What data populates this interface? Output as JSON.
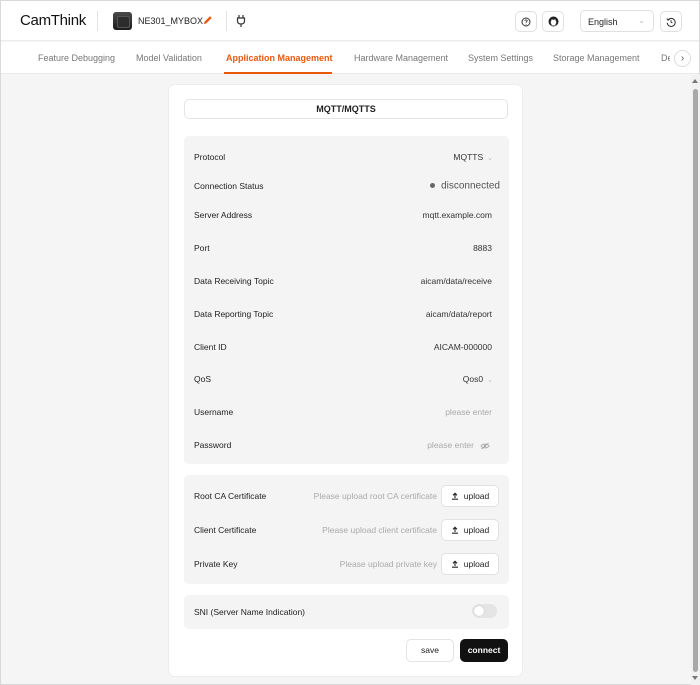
{
  "header": {
    "logo": "CamThink",
    "device_name": "NE301_MYBOX",
    "language": "English"
  },
  "tabs": [
    {
      "label": "Feature Debugging"
    },
    {
      "label": "Model Validation"
    },
    {
      "label": "Application Management",
      "active": true
    },
    {
      "label": "Hardware Management"
    },
    {
      "label": "System Settings"
    },
    {
      "label": "Storage Management"
    },
    {
      "label": "De"
    }
  ],
  "protocol_tab": "MQTT/MQTTS",
  "settings": {
    "protocol": {
      "label": "Protocol",
      "value": "MQTTS"
    },
    "connection_status": {
      "label": "Connection Status",
      "value": "disconnected"
    },
    "server_address": {
      "label": "Server Address",
      "value": "mqtt.example.com"
    },
    "port": {
      "label": "Port",
      "value": "8883"
    },
    "receiving_topic": {
      "label": "Data Receiving Topic",
      "value": "aicam/data/receive"
    },
    "reporting_topic": {
      "label": "Data Reporting Topic",
      "value": "aicam/data/report"
    },
    "client_id": {
      "label": "Client ID",
      "value": "AICAM-000000"
    },
    "qos": {
      "label": "QoS",
      "value": "Qos0"
    },
    "username": {
      "label": "Username",
      "placeholder": "please enter"
    },
    "password": {
      "label": "Password",
      "placeholder": "please enter"
    }
  },
  "certificates": {
    "root_ca": {
      "label": "Root CA Certificate",
      "hint": "Please upload root CA certificate",
      "button": "upload"
    },
    "client_cert": {
      "label": "Client Certificate",
      "hint": "Please upload client certificate",
      "button": "upload"
    },
    "private_key": {
      "label": "Private Key",
      "hint": "Please upload private key",
      "button": "upload"
    }
  },
  "sni": {
    "label": "SNI (Server Name Indication)",
    "enabled": false
  },
  "actions": {
    "save": "save",
    "connect": "connect"
  },
  "colors": {
    "accent": "#e8590c",
    "primary_button": "#111111"
  }
}
